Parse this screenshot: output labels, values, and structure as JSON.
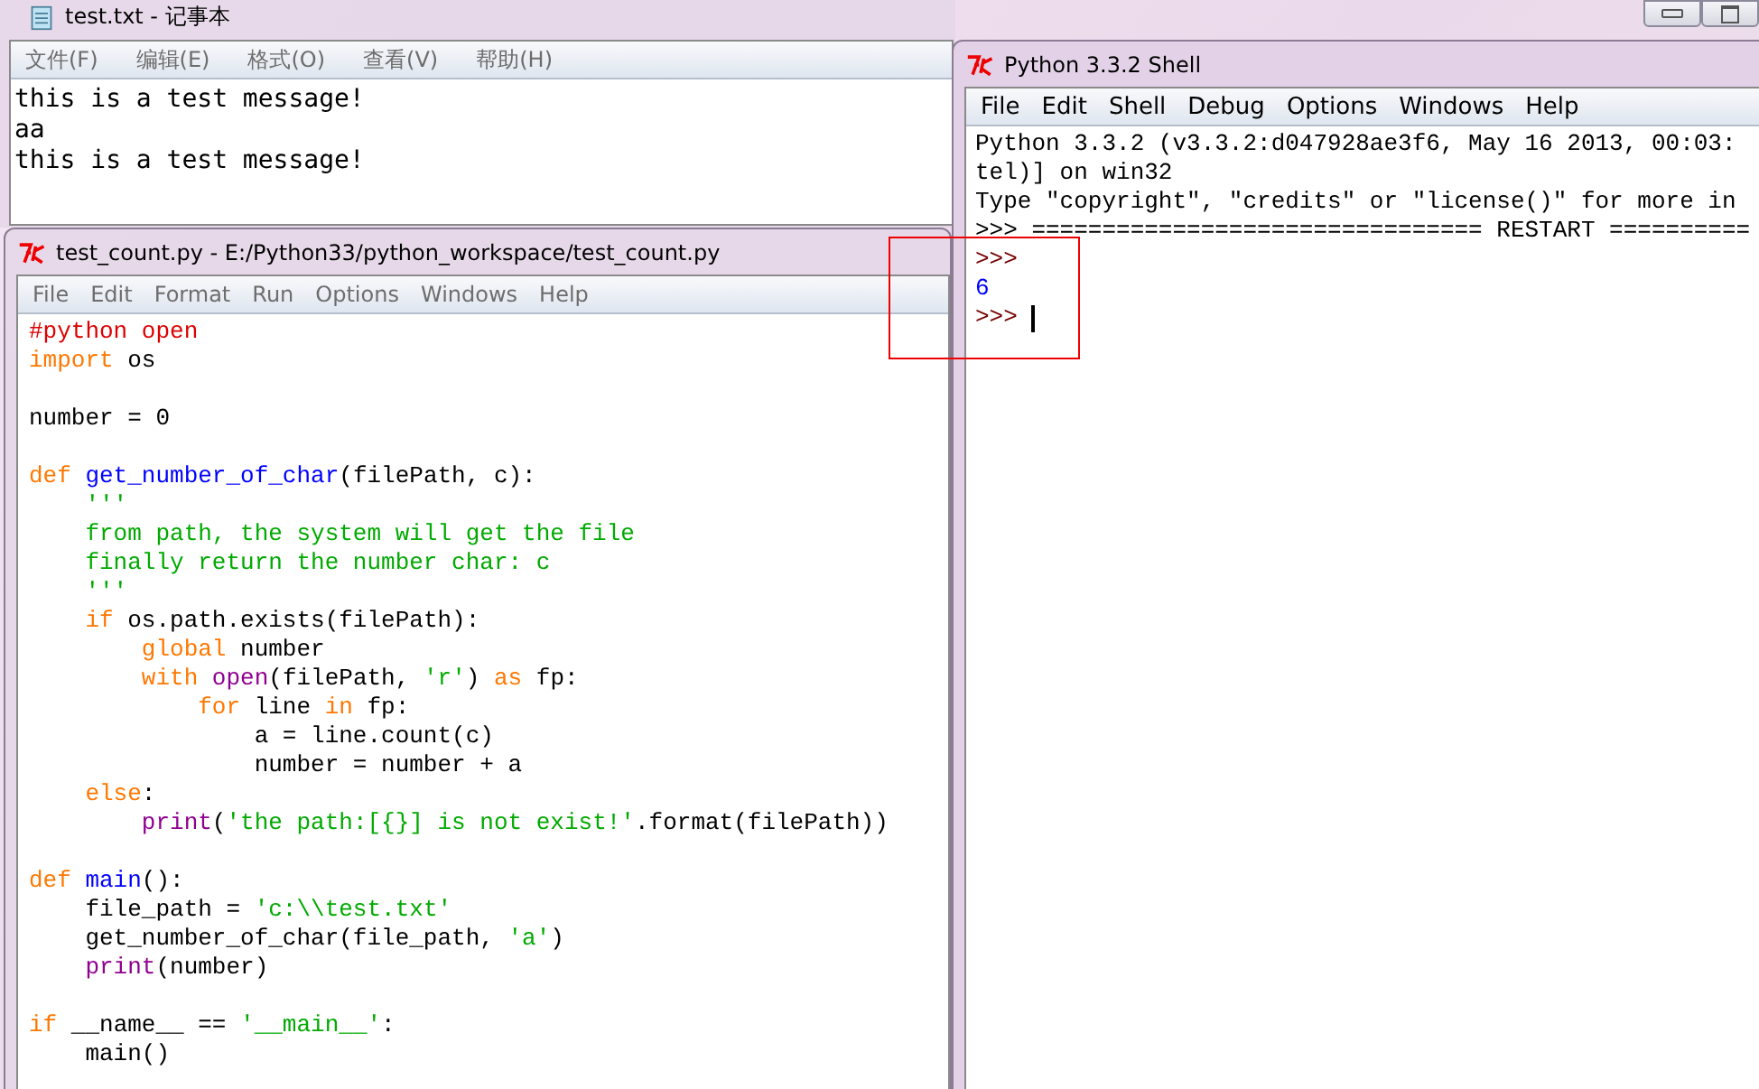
{
  "notepad": {
    "title": "test.txt - 记事本",
    "menu": [
      "文件(F)",
      "编辑(E)",
      "格式(O)",
      "查看(V)",
      "帮助(H)"
    ],
    "lines": [
      "this is a test message!",
      "aa",
      "this is a test message!"
    ]
  },
  "editor": {
    "title": "test_count.py - E:/Python33/python_workspace/test_count.py",
    "menu": [
      "File",
      "Edit",
      "Format",
      "Run",
      "Options",
      "Windows",
      "Help"
    ],
    "lines": [
      {
        "kind": "code",
        "tokens": [
          {
            "kind": "comment",
            "text": "#python open"
          }
        ]
      },
      {
        "kind": "code",
        "tokens": [
          {
            "kind": "keyword",
            "text": "import"
          },
          {
            "kind": "plain",
            "text": " os"
          }
        ]
      },
      {
        "kind": "blank"
      },
      {
        "kind": "code",
        "tokens": [
          {
            "kind": "plain",
            "text": "number = 0"
          }
        ]
      },
      {
        "kind": "blank"
      },
      {
        "kind": "code",
        "tokens": [
          {
            "kind": "keyword",
            "text": "def"
          },
          {
            "kind": "defname",
            "text": " get_number_of_char"
          },
          {
            "kind": "plain",
            "text": "(filePath, c):"
          }
        ]
      },
      {
        "kind": "code",
        "tokens": [
          {
            "kind": "string",
            "text": "    '''"
          }
        ]
      },
      {
        "kind": "code",
        "tokens": [
          {
            "kind": "string",
            "text": "    from path, the system will get the file"
          }
        ]
      },
      {
        "kind": "code",
        "tokens": [
          {
            "kind": "string",
            "text": "    finally return the number char: c"
          }
        ]
      },
      {
        "kind": "code",
        "tokens": [
          {
            "kind": "string",
            "text": "    '''"
          }
        ]
      },
      {
        "kind": "code",
        "tokens": [
          {
            "kind": "keyword",
            "text": "    if"
          },
          {
            "kind": "plain",
            "text": " os.path.exists(filePath):"
          }
        ]
      },
      {
        "kind": "code",
        "tokens": [
          {
            "kind": "keyword",
            "text": "        global"
          },
          {
            "kind": "plain",
            "text": " number"
          }
        ]
      },
      {
        "kind": "code",
        "tokens": [
          {
            "kind": "keyword",
            "text": "        with"
          },
          {
            "kind": "builtin",
            "text": " open"
          },
          {
            "kind": "plain",
            "text": "(filePath, "
          },
          {
            "kind": "string",
            "text": "'r'"
          },
          {
            "kind": "plain",
            "text": ") "
          },
          {
            "kind": "keyword",
            "text": "as"
          },
          {
            "kind": "plain",
            "text": " fp:"
          }
        ]
      },
      {
        "kind": "code",
        "tokens": [
          {
            "kind": "keyword",
            "text": "            for"
          },
          {
            "kind": "plain",
            "text": " line "
          },
          {
            "kind": "keyword",
            "text": "in"
          },
          {
            "kind": "plain",
            "text": " fp:"
          }
        ]
      },
      {
        "kind": "code",
        "tokens": [
          {
            "kind": "plain",
            "text": "                a = line.count(c)"
          }
        ]
      },
      {
        "kind": "code",
        "tokens": [
          {
            "kind": "plain",
            "text": "                number = number + a"
          }
        ]
      },
      {
        "kind": "code",
        "tokens": [
          {
            "kind": "keyword",
            "text": "    else"
          },
          {
            "kind": "plain",
            "text": ":"
          }
        ]
      },
      {
        "kind": "code",
        "tokens": [
          {
            "kind": "builtin",
            "text": "        print"
          },
          {
            "kind": "plain",
            "text": "("
          },
          {
            "kind": "string",
            "text": "'the path:[{}] is not exist!'"
          },
          {
            "kind": "plain",
            "text": ".format(filePath))"
          }
        ]
      },
      {
        "kind": "blank"
      },
      {
        "kind": "code",
        "tokens": [
          {
            "kind": "keyword",
            "text": "def"
          },
          {
            "kind": "defname",
            "text": " main"
          },
          {
            "kind": "plain",
            "text": "():"
          }
        ]
      },
      {
        "kind": "code",
        "tokens": [
          {
            "kind": "plain",
            "text": "    file_path = "
          },
          {
            "kind": "string",
            "text": "'c:\\\\test.txt'"
          }
        ]
      },
      {
        "kind": "code",
        "tokens": [
          {
            "kind": "plain",
            "text": "    get_number_of_char(file_path, "
          },
          {
            "kind": "string",
            "text": "'a'"
          },
          {
            "kind": "plain",
            "text": ")"
          }
        ]
      },
      {
        "kind": "code",
        "tokens": [
          {
            "kind": "builtin",
            "text": "    print"
          },
          {
            "kind": "plain",
            "text": "(number)"
          }
        ]
      },
      {
        "kind": "blank"
      },
      {
        "kind": "code",
        "tokens": [
          {
            "kind": "keyword",
            "text": "if"
          },
          {
            "kind": "plain",
            "text": " __name__ == "
          },
          {
            "kind": "string",
            "text": "'__main__'"
          },
          {
            "kind": "plain",
            "text": ":"
          }
        ]
      },
      {
        "kind": "code",
        "tokens": [
          {
            "kind": "plain",
            "text": "    main()"
          }
        ]
      }
    ]
  },
  "shell": {
    "title": "Python 3.3.2 Shell",
    "menu": [
      "File",
      "Edit",
      "Shell",
      "Debug",
      "Options",
      "Windows",
      "Help"
    ],
    "lines": [
      {
        "kind": "output",
        "text": "Python 3.3.2 (v3.3.2:d047928ae3f6, May 16 2013, 00:03:"
      },
      {
        "kind": "output",
        "text": "tel)] on win32"
      },
      {
        "kind": "output",
        "text": "Type \"copyright\", \"credits\" or \"license()\" for more in"
      },
      {
        "kind": "output",
        "text": ">>> ================================ RESTART =========="
      },
      {
        "kind": "prompt",
        "text": ">>>"
      },
      {
        "kind": "result",
        "text": "6"
      },
      {
        "kind": "prompt",
        "text": ">>>",
        "cursor": true
      }
    ]
  }
}
